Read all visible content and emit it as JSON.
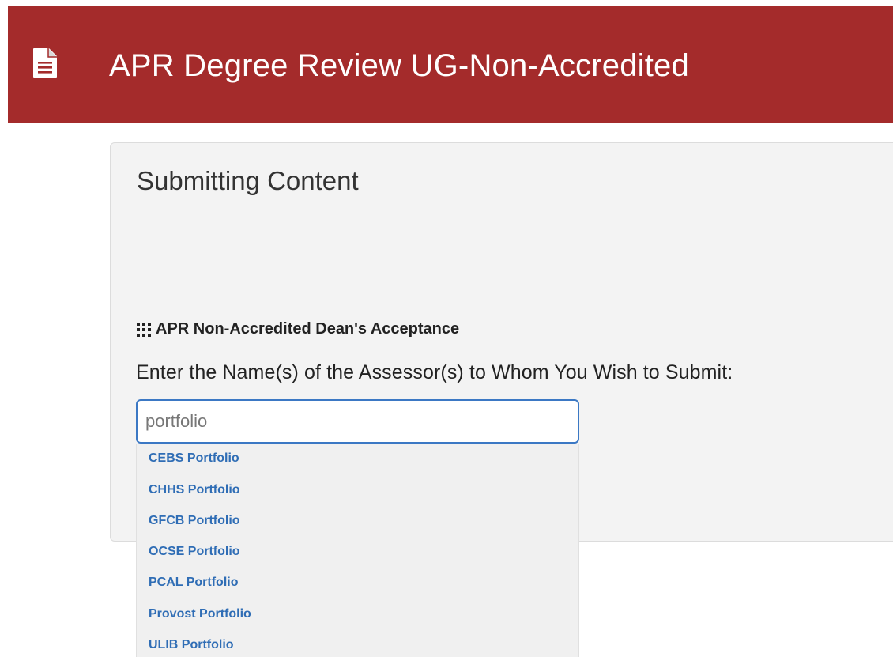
{
  "header": {
    "title": "APR Degree Review UG-Non-Accredited",
    "icon": "document-icon",
    "background_color": "#a42b2b"
  },
  "panel": {
    "title": "Submitting Content"
  },
  "section": {
    "icon": "grid-icon",
    "heading": "APR Non-Accredited Dean's Acceptance",
    "prompt": "Enter the Name(s) of the Assessor(s) to Whom You Wish to Submit:"
  },
  "search": {
    "value": "portfolio"
  },
  "suggestions": [
    {
      "label": "CEBS Portfolio"
    },
    {
      "label": "CHHS Portfolio"
    },
    {
      "label": "GFCB Portfolio"
    },
    {
      "label": "OCSE Portfolio"
    },
    {
      "label": "PCAL Portfolio"
    },
    {
      "label": "Provost Portfolio"
    },
    {
      "label": "ULIB Portfolio"
    }
  ],
  "colors": {
    "link": "#2f6db5",
    "input_border": "#3b78c4"
  }
}
